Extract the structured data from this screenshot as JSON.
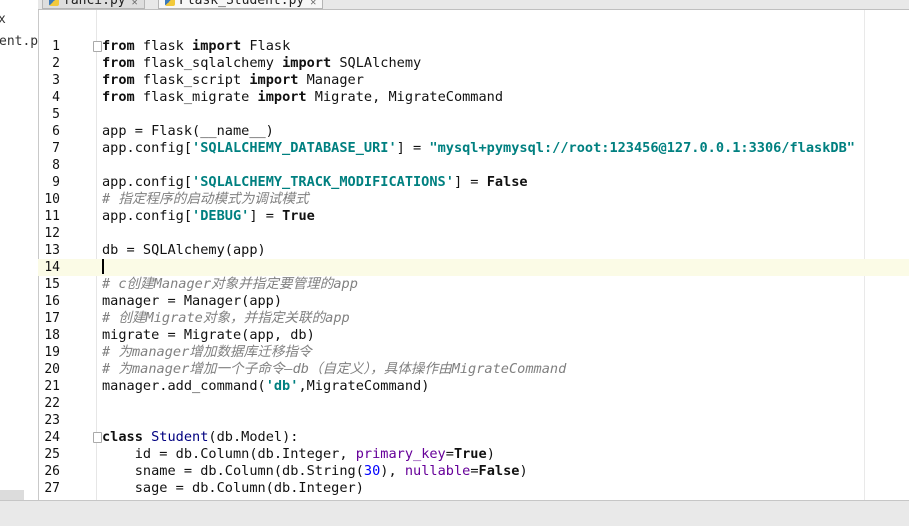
{
  "tabs": [
    {
      "label": "fanci.py",
      "active": false
    },
    {
      "label": "Flask_Student.py",
      "active": true
    }
  ],
  "project_panel": {
    "items": [
      "x",
      "ent.p"
    ]
  },
  "editor": {
    "current_line": 14,
    "lines": [
      {
        "n": "1",
        "tokens": [
          [
            "kw",
            "from"
          ],
          [
            "t",
            " flask "
          ],
          [
            "kw",
            "import"
          ],
          [
            "t",
            " Flask"
          ]
        ]
      },
      {
        "n": "2",
        "tokens": [
          [
            "kw",
            "from"
          ],
          [
            "t",
            " flask_sqlalchemy "
          ],
          [
            "kw",
            "import"
          ],
          [
            "t",
            " SQLAlchemy"
          ]
        ]
      },
      {
        "n": "3",
        "tokens": [
          [
            "kw",
            "from"
          ],
          [
            "t",
            " flask_script "
          ],
          [
            "kw",
            "import"
          ],
          [
            "t",
            " Manager"
          ]
        ]
      },
      {
        "n": "4",
        "tokens": [
          [
            "kw",
            "from"
          ],
          [
            "t",
            " flask_migrate "
          ],
          [
            "kw",
            "import"
          ],
          [
            "t",
            " Migrate, MigrateCommand"
          ]
        ]
      },
      {
        "n": "5",
        "tokens": []
      },
      {
        "n": "6",
        "tokens": [
          [
            "t",
            "app = Flask(__name__)"
          ]
        ]
      },
      {
        "n": "7",
        "tokens": [
          [
            "t",
            "app.config["
          ],
          [
            "str",
            "'SQLALCHEMY_DATABASE_URI'"
          ],
          [
            "t",
            "] = "
          ],
          [
            "str",
            "\"mysql+pymysql://root:123456@127.0.0.1:3306/flaskDB\""
          ]
        ]
      },
      {
        "n": "8",
        "tokens": []
      },
      {
        "n": "9",
        "tokens": [
          [
            "t",
            "app.config["
          ],
          [
            "str",
            "'SQLALCHEMY_TRACK_MODIFICATIONS'"
          ],
          [
            "t",
            "] = "
          ],
          [
            "kw",
            "False"
          ]
        ]
      },
      {
        "n": "10",
        "tokens": [
          [
            "cmt",
            "# 指定程序的启动模式为调试模式"
          ]
        ]
      },
      {
        "n": "11",
        "tokens": [
          [
            "t",
            "app.config["
          ],
          [
            "str",
            "'DEBUG'"
          ],
          [
            "t",
            "] = "
          ],
          [
            "kw",
            "True"
          ]
        ]
      },
      {
        "n": "12",
        "tokens": []
      },
      {
        "n": "13",
        "tokens": [
          [
            "t",
            "db = SQLAlchemy(app)"
          ]
        ]
      },
      {
        "n": "14",
        "tokens": []
      },
      {
        "n": "15",
        "tokens": [
          [
            "cmt",
            "# c创建Manager对象并指定要管理的app"
          ]
        ]
      },
      {
        "n": "16",
        "tokens": [
          [
            "t",
            "manager = Manager(app)"
          ]
        ]
      },
      {
        "n": "17",
        "tokens": [
          [
            "cmt",
            "# 创建Migrate对象，并指定关联的app"
          ]
        ]
      },
      {
        "n": "18",
        "tokens": [
          [
            "t",
            "migrate = Migrate(app, db)"
          ]
        ]
      },
      {
        "n": "19",
        "tokens": [
          [
            "cmt",
            "# 为manager增加数据库迁移指令"
          ]
        ]
      },
      {
        "n": "20",
        "tokens": [
          [
            "cmt",
            "# 为manager增加一个子命令—db（自定义），具体操作由MigrateCommand"
          ]
        ]
      },
      {
        "n": "21",
        "tokens": [
          [
            "t",
            "manager.add_command("
          ],
          [
            "str",
            "'db'"
          ],
          [
            "t",
            ",MigrateCommand)"
          ]
        ]
      },
      {
        "n": "22",
        "tokens": []
      },
      {
        "n": "23",
        "tokens": []
      },
      {
        "n": "24",
        "tokens": [
          [
            "kw",
            "class"
          ],
          [
            "t",
            " "
          ],
          [
            "cls",
            "Student"
          ],
          [
            "t",
            "(db.Model):"
          ]
        ]
      },
      {
        "n": "25",
        "tokens": [
          [
            "t",
            "    id = db.Column(db.Integer, "
          ],
          [
            "kwarg",
            "primary_key"
          ],
          [
            "t",
            "="
          ],
          [
            "kw",
            "True"
          ],
          [
            "t",
            ")"
          ]
        ]
      },
      {
        "n": "26",
        "tokens": [
          [
            "t",
            "    sname = db.Column(db.String("
          ],
          [
            "num",
            "30"
          ],
          [
            "t",
            "), "
          ],
          [
            "kwarg",
            "nullable"
          ],
          [
            "t",
            "="
          ],
          [
            "kw",
            "False"
          ],
          [
            "t",
            ")"
          ]
        ]
      },
      {
        "n": "27",
        "tokens": [
          [
            "t",
            "    sage = db.Column(db.Integer)"
          ]
        ]
      }
    ]
  }
}
